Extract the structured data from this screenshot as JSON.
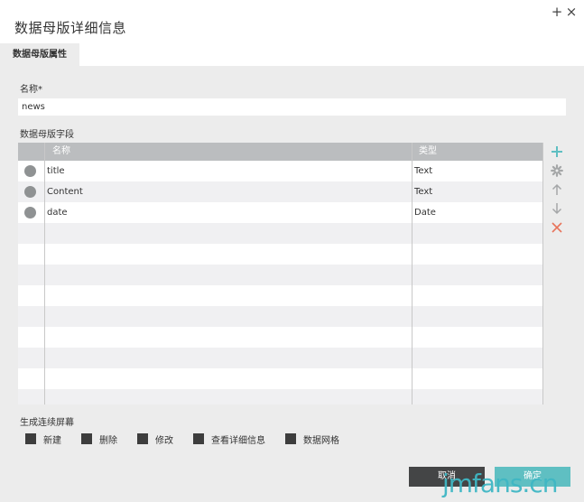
{
  "window": {
    "title": "数据母版详细信息",
    "add_glyph": "+",
    "close_glyph": "×"
  },
  "tabs": [
    {
      "label": "数据母版属性",
      "active": true
    }
  ],
  "form": {
    "name_label": "名称*",
    "name_value": "news",
    "fields_label": "数据母版字段"
  },
  "table": {
    "columns": [
      "名称",
      "类型"
    ],
    "rows": [
      {
        "name": "title",
        "type": "Text"
      },
      {
        "name": "Content",
        "type": "Text"
      },
      {
        "name": "date",
        "type": "Date"
      }
    ]
  },
  "tools": [
    "add-icon",
    "gear-icon",
    "arrow-up-icon",
    "arrow-down-icon",
    "delete-icon"
  ],
  "generate": {
    "label": "生成连续屏幕",
    "options": [
      "新建",
      "删除",
      "修改",
      "查看详细信息",
      "数据网格"
    ]
  },
  "buttons": {
    "cancel": "取消",
    "ok": "确定"
  },
  "watermark": "jmfans.cn",
  "colors": {
    "accent": "#5fbfc2",
    "delete": "#e8735a",
    "header": "#bbbdbf",
    "panel": "#ececec"
  }
}
